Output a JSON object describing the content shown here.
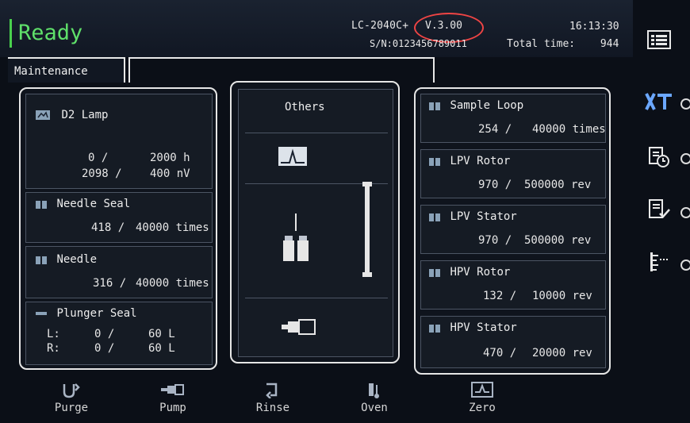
{
  "status": "Ready",
  "header": {
    "model": "LC-2040C+",
    "version": "V.3.00",
    "serial": "S/N:0123456789011",
    "clock": "16:13:30",
    "total_label": "Total time:",
    "total_value": "944"
  },
  "tab_label": "Maintenance",
  "left": {
    "d2_title": "D2 Lamp",
    "d2_v1_left": "0 /",
    "d2_v1_right": "2000 h",
    "d2_v2_left": "2098 /",
    "d2_v2_right": "400 nV",
    "needle_seal_title": "Needle Seal",
    "needle_seal_left": "418 /",
    "needle_seal_right": "40000 times",
    "needle_title": "Needle",
    "needle_left": "316 /",
    "needle_right": "40000 times",
    "plunger_title": "Plunger Seal",
    "plunger_L_label": "L:",
    "plunger_L_left": "0 /",
    "plunger_L_right": "60 L",
    "plunger_R_label": "R:",
    "plunger_R_left": "0 /",
    "plunger_R_right": "60 L"
  },
  "middle": {
    "title": "Others"
  },
  "right": {
    "sample_loop_title": "Sample Loop",
    "sample_loop_left": "254 /",
    "sample_loop_right": "40000 times",
    "lpv_rotor_title": "LPV Rotor",
    "lpv_rotor_left": "970 /",
    "lpv_rotor_right": "500000 rev",
    "lpv_stator_title": "LPV Stator",
    "lpv_stator_left": "970 /",
    "lpv_stator_right": "500000 rev",
    "hpv_rotor_title": "HPV Rotor",
    "hpv_rotor_left": "132 /",
    "hpv_rotor_right": "10000 rev",
    "hpv_stator_title": "HPV Stator",
    "hpv_stator_left": "470 /",
    "hpv_stator_right": "20000 rev"
  },
  "bottom": {
    "purge": "Purge",
    "pump": "Pump",
    "rinse": "Rinse",
    "oven": "Oven",
    "zero": "Zero"
  },
  "colors": {
    "ready": "#5fe06a",
    "accent_ring": "#e44444",
    "frame": "#e6e6e6"
  }
}
